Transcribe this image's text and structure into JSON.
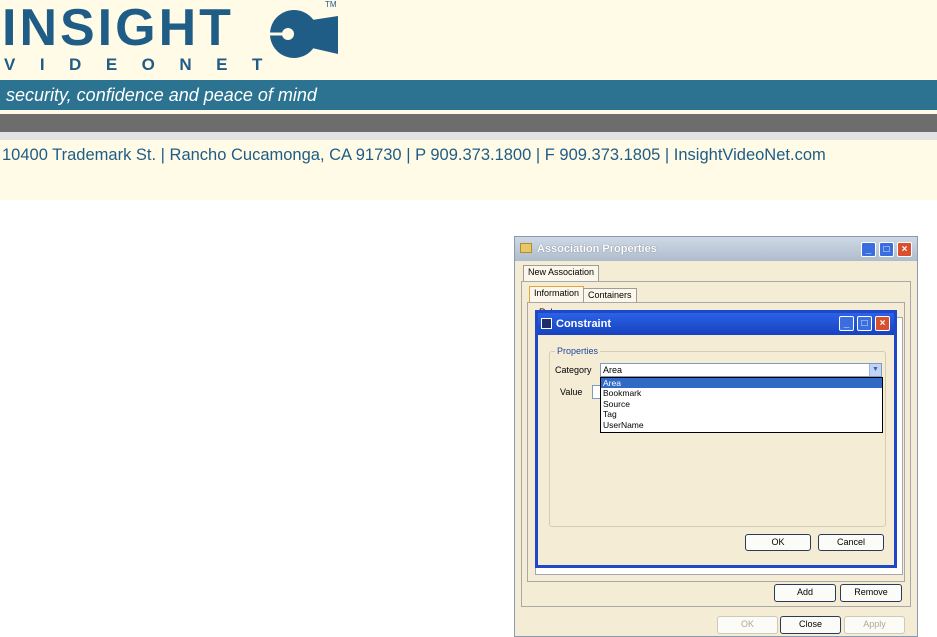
{
  "header": {
    "logo_word": "INSIGHT",
    "logo_tm": "TM",
    "logo_sub": "VIDEONET",
    "tagline": "security, confidence and peace of mind",
    "address": "10400 Trademark St.  |  Rancho Cucamonga, CA 91730  |  P 909.373.1800  | F 909.373.1805  |  InsightVideoNet.com"
  },
  "colors": {
    "brand_blue": "#1f5d87",
    "band_teal": "#2b7390",
    "xp_blue": "#1f48c8",
    "selection": "#316ac5"
  },
  "assoc_window": {
    "title": "Association Properties",
    "tab_outer": "New Association",
    "tab_information": "Information",
    "tab_containers": "Containers",
    "rule_label": "Rule",
    "add_button": "Add",
    "remove_button": "Remove",
    "ok_button": "OK",
    "close_button": "Close",
    "apply_button": "Apply",
    "minimize_icon": "minimize-icon",
    "maximize_icon": "maximize-icon",
    "close_icon": "close-icon"
  },
  "constraint_dialog": {
    "title": "Constraint",
    "group_label": "Properties",
    "category_label": "Category",
    "category_selected": "Area",
    "value_label": "Value",
    "options": [
      "Area",
      "Bookmark",
      "Source",
      "Tag",
      "UserName"
    ],
    "ok_button": "OK",
    "cancel_button": "Cancel"
  }
}
